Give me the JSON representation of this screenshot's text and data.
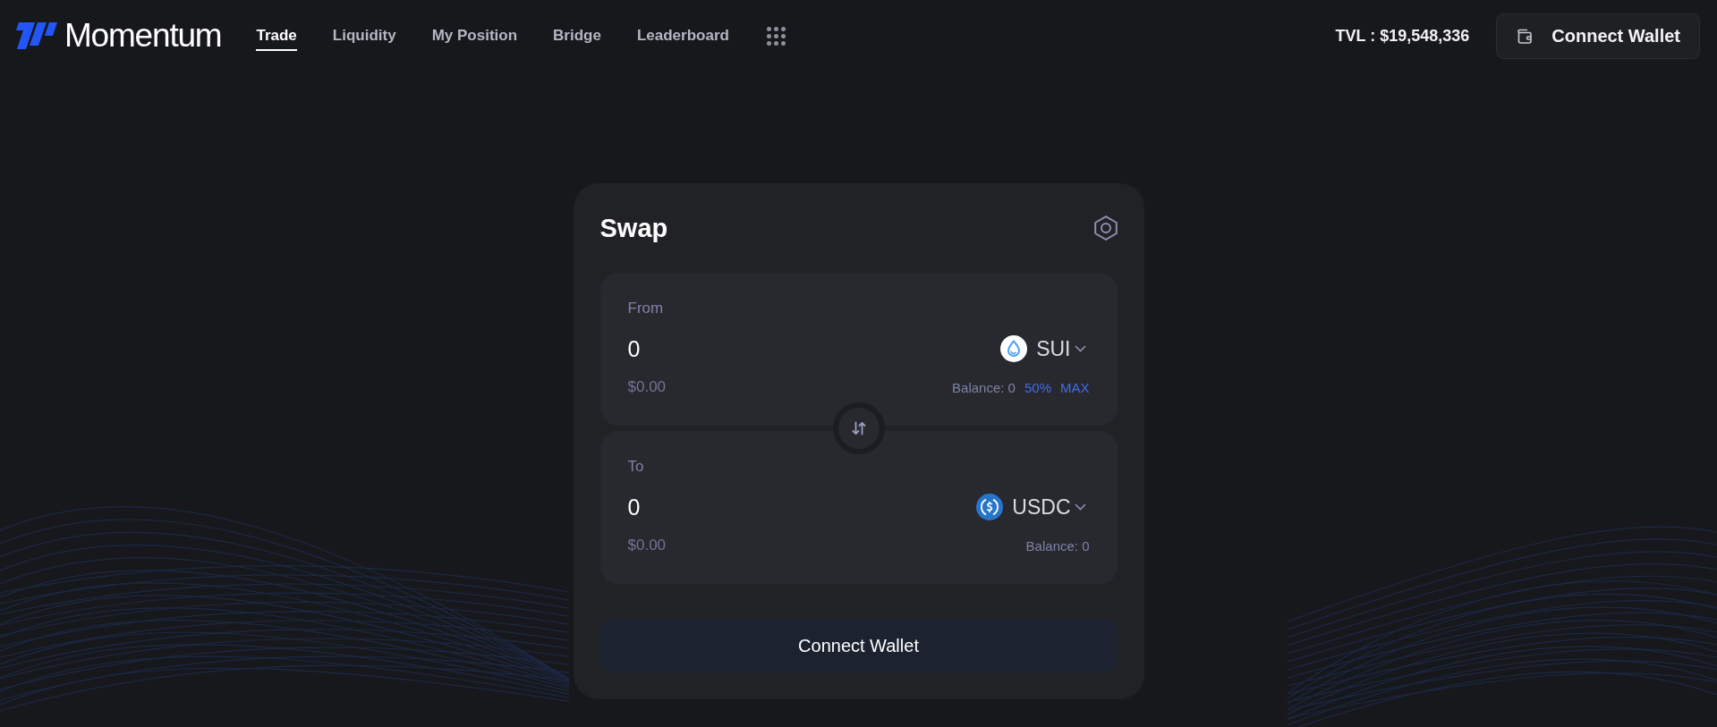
{
  "header": {
    "logo": "Momentum",
    "nav": [
      {
        "label": "Trade",
        "selected": true
      },
      {
        "label": "Liquidity",
        "selected": false
      },
      {
        "label": "My Position",
        "selected": false
      },
      {
        "label": "Bridge",
        "selected": false
      },
      {
        "label": "Leaderboard",
        "selected": false
      }
    ],
    "tvl": "TVL : $19,548,336",
    "connect_button": "Connect Wallet"
  },
  "swap": {
    "title": "Swap",
    "panels": [
      {
        "label": "From",
        "amount": "0",
        "usd_value": "$0.00",
        "token": {
          "symbol": "SUI",
          "kind": "sui"
        },
        "balance": "Balance: 0",
        "quick_amounts": [
          "50%",
          "MAX"
        ]
      },
      {
        "label": "To",
        "amount": "0",
        "usd_value": "$0.00",
        "token": {
          "symbol": "USDC",
          "kind": "usdc"
        },
        "balance": "Balance: 0"
      }
    ],
    "action_button": "Connect Wallet"
  }
}
